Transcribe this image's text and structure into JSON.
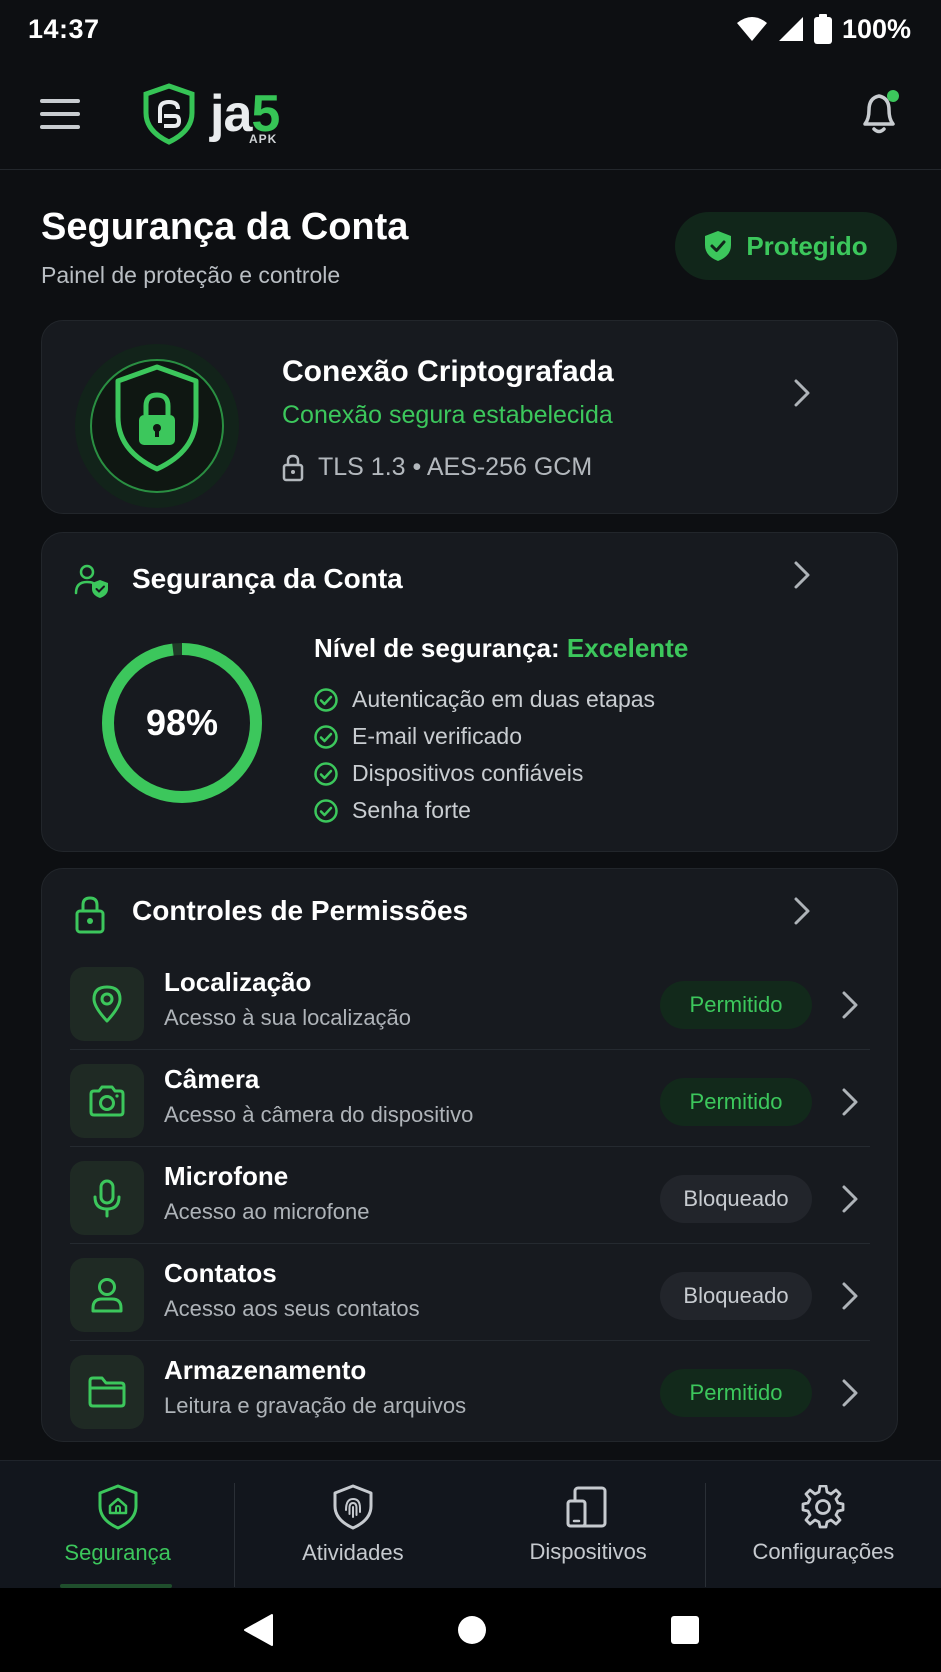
{
  "status_bar": {
    "time": "14:37",
    "battery": "100%"
  },
  "app": {
    "logo_main": "ja",
    "logo_five": "5",
    "logo_sub": "APK"
  },
  "header": {
    "title": "Segurança da Conta",
    "subtitle": "Painel de proteção e controle",
    "badge": "Protegido"
  },
  "connection": {
    "title": "Conexão Criptografada",
    "status": "Conexão segura estabelecida",
    "protocol": "TLS 1.3 • AES-256 GCM"
  },
  "account_security": {
    "title": "Segurança da Conta",
    "score_text": "98%",
    "score_fraction": 0.98,
    "level_label": "Nível de segurança: ",
    "level_value": "Excelente",
    "checks": [
      "Autenticação em duas etapas",
      "E-mail verificado",
      "Dispositivos confiáveis",
      "Senha forte"
    ]
  },
  "permissions": {
    "title": "Controles de Permissões",
    "items": [
      {
        "name": "Localização",
        "desc": "Acesso à sua localização",
        "status": "Permitido"
      },
      {
        "name": "Câmera",
        "desc": "Acesso à câmera do dispositivo",
        "status": "Permitido"
      },
      {
        "name": "Microfone",
        "desc": "Acesso ao microfone",
        "status": "Bloqueado"
      },
      {
        "name": "Contatos",
        "desc": "Acesso aos seus contatos",
        "status": "Bloqueado"
      },
      {
        "name": "Armazenamento",
        "desc": "Leitura e gravação de arquivos",
        "status": "Permitido"
      }
    ]
  },
  "bottom_nav": [
    {
      "label": "Segurança",
      "icon": "shield-home-icon",
      "active": true
    },
    {
      "label": "Atividades",
      "icon": "fingerprint-shield-icon",
      "active": false
    },
    {
      "label": "Dispositivos",
      "icon": "devices-icon",
      "active": false
    },
    {
      "label": "Configurações",
      "icon": "gear-icon",
      "active": false
    }
  ],
  "colors": {
    "accent": "#3cc75c",
    "background": "#0d0f12",
    "card": "#171a1f"
  }
}
